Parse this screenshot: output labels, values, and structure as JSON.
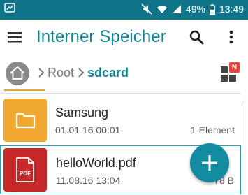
{
  "status_bar": {
    "battery_percent": "49%",
    "time": "13:49",
    "icons": [
      "notification-icon",
      "mute-icon",
      "wifi-icon",
      "signal-icon",
      "battery-icon"
    ]
  },
  "app_bar": {
    "title": "Interner Speicher",
    "icons": [
      "menu-icon",
      "search-icon",
      "more-vert-icon"
    ]
  },
  "breadcrumb": {
    "home_icon": "home-icon",
    "items": [
      {
        "label": "Root"
      },
      {
        "label": "sdcard"
      }
    ],
    "view_toggle_icon": "grid-view-icon",
    "badge": "N"
  },
  "files": [
    {
      "name": "Samsung",
      "date": "01.01.16 00:01",
      "size": "1 Element",
      "type": "folder",
      "icon": "folder-icon"
    },
    {
      "name": "helloWorld.pdf",
      "date": "11.08.16 13:04",
      "size": "78 B",
      "type": "pdf",
      "icon": "pdf-icon",
      "thumb_label": "PDF",
      "selected": true
    }
  ],
  "fab": {
    "icon": "add-icon"
  },
  "colors": {
    "status_bar": "#0f7488",
    "accent": "#128296",
    "folder": "#f0a830",
    "pdf": "#c62828",
    "fab": "#128ba0",
    "badge": "#e8453c"
  }
}
